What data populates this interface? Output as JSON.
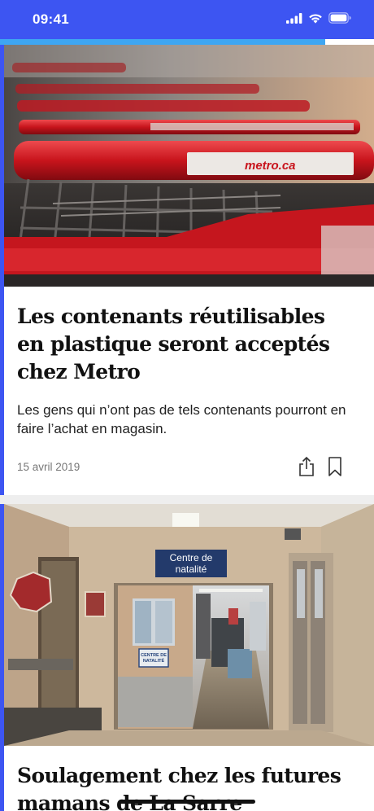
{
  "status_bar": {
    "time": "09:41",
    "icons": [
      "cellular-signal-icon",
      "wifi-icon",
      "battery-icon"
    ]
  },
  "reading_progress": {
    "fraction": 0.87
  },
  "articles": [
    {
      "image": "shopping-carts-metro-photo",
      "title": "Les contenants réutilisables en plastique seront acceptés chez Metro",
      "summary": "Les gens qui n’ont pas de tels contenants pourront en faire l’achat en magasin.",
      "date": "15 avril 2019"
    },
    {
      "image": "hospital-birth-center-corridor-photo",
      "title": "Soulagement chez les futures mamans de La Sarre"
    }
  ],
  "image_text": {
    "metro_logo": "metro.ca",
    "hospital_sign": [
      "Centre de",
      "natalité"
    ],
    "door_sign": [
      "CENTRE DE",
      "NATALITÉ"
    ]
  },
  "colors": {
    "brand_blue": "#3d55f2",
    "progress": "#3ea6f2",
    "cart_red": "#c8141c",
    "separator": "#eeeeee"
  }
}
